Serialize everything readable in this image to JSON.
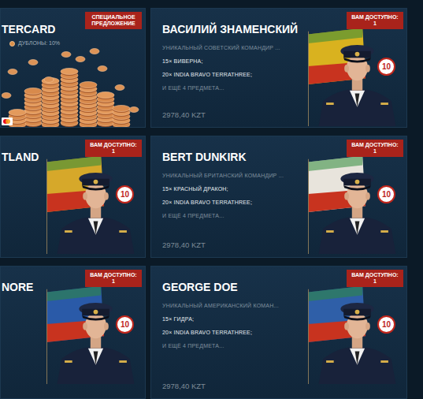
{
  "cards": [
    {
      "kind": "offer",
      "title": "TERCARD",
      "badge": "СПЕЦИАЛЬНОЕ ПРЕДЛОЖЕНИЕ",
      "lines": [
        "ДУБЛОНЫ: 10%"
      ]
    },
    {
      "kind": "commander",
      "title": "ВАСИЛИЙ ЗНАМЕНСКИЙ",
      "badge": "ВАМ ДОСТУПНО: 1",
      "lines": [
        "УНИКАЛЬНЫЙ СОВЕТСКИЙ КОМАНДИР ...",
        "15× ВИВЕРНА;",
        "20× INDIA BRAVO TERRATHREE;",
        "И ЕЩЁ 4 ПРЕДМЕТА..."
      ],
      "price": "2978,40 KZT",
      "rank": "10",
      "color": "#d9b21f"
    },
    {
      "kind": "commander",
      "title": "TLAND",
      "badge": "ВАМ ДОСТУПНО: 1",
      "lines": [],
      "rank": "10",
      "color": "#d6a82a"
    },
    {
      "kind": "commander",
      "title": "BERT DUNKIRK",
      "badge": "ВАМ ДОСТУПНО: 1",
      "lines": [
        "УНИКАЛЬНЫЙ БРИТАНСКИЙ КОМАНДИР ...",
        "15× КРАСНЫЙ ДРАКОН;",
        "20× INDIA BRAVO TERRATHREE;",
        "И ЕЩЁ 4 ПРЕДМЕТА..."
      ],
      "price": "2978,40 KZT",
      "rank": "10",
      "color": "#e8e4dc"
    },
    {
      "kind": "commander",
      "title": "NORE",
      "badge": "ВАМ ДОСТУПНО: 1",
      "lines": [],
      "rank": "10",
      "color": "#2a5aa8"
    },
    {
      "kind": "commander",
      "title": "GEORGE DOE",
      "badge": "ВАМ ДОСТУПНО: 1",
      "lines": [
        "УНИКАЛЬНЫЙ АМЕРИКАНСКИЙ КОМАН...",
        "15× ГИДРА;",
        "20× INDIA BRAVO TERRATHREE;",
        "И ЕЩЁ 4 ПРЕДМЕТА..."
      ],
      "price": "2978,40 KZT",
      "rank": "10",
      "color": "#2f5fa8"
    }
  ]
}
